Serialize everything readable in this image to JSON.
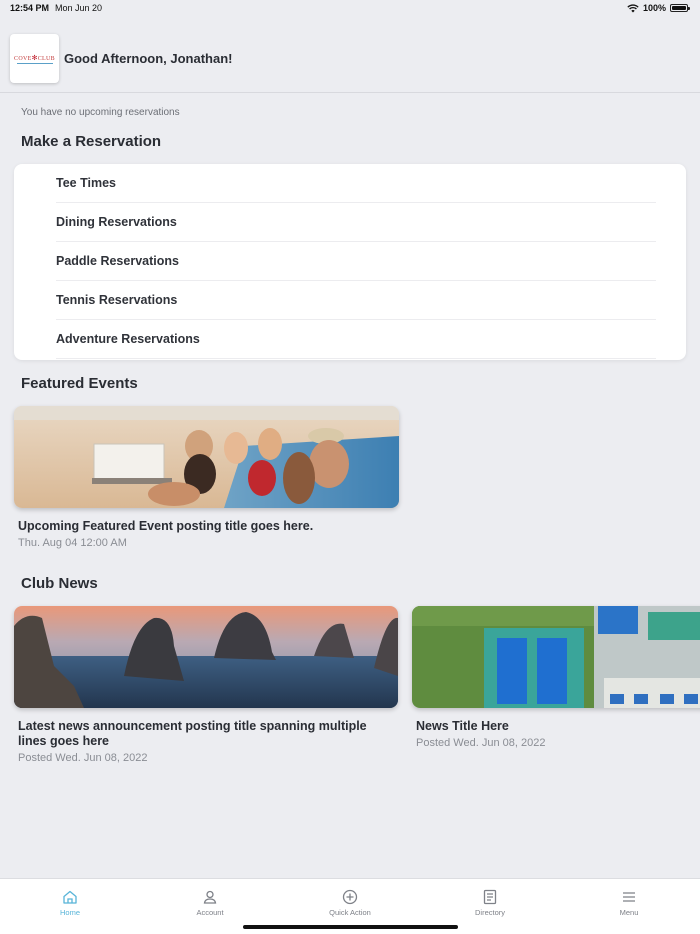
{
  "status_bar": {
    "time": "12:54 PM",
    "date": "Mon Jun 20",
    "battery": "100%"
  },
  "header": {
    "logo_text": "COVE",
    "logo_text2": "CLUB",
    "greeting": "Good Afternoon, Jonathan!"
  },
  "reservations_status": "You have no upcoming reservations",
  "make_reservation": {
    "title": "Make a Reservation",
    "items": [
      {
        "label": "Tee Times"
      },
      {
        "label": "Dining Reservations"
      },
      {
        "label": "Paddle Reservations"
      },
      {
        "label": "Tennis Reservations"
      },
      {
        "label": "Adventure Reservations"
      }
    ]
  },
  "featured_events": {
    "title": "Featured Events",
    "items": [
      {
        "title": "Upcoming Featured Event posting title goes here.",
        "date": "Thu. Aug 04 12:00 AM"
      }
    ]
  },
  "club_news": {
    "title": "Club News",
    "items": [
      {
        "title": "Latest news announcement posting title spanning multiple lines goes here",
        "date": "Posted Wed. Jun 08, 2022"
      },
      {
        "title": "News Title Here",
        "date": "Posted Wed. Jun 08, 2022"
      }
    ]
  },
  "tabbar": {
    "items": [
      {
        "label": "Home",
        "icon": "home-icon"
      },
      {
        "label": "Account",
        "icon": "person-icon"
      },
      {
        "label": "Quick Action",
        "icon": "plus-circle-icon"
      },
      {
        "label": "Directory",
        "icon": "directory-icon"
      },
      {
        "label": "Menu",
        "icon": "hamburger-icon"
      }
    ]
  },
  "colors": {
    "background": "#ecedf1",
    "accent": "#58b4d8",
    "logo_red": "#c0212f"
  }
}
